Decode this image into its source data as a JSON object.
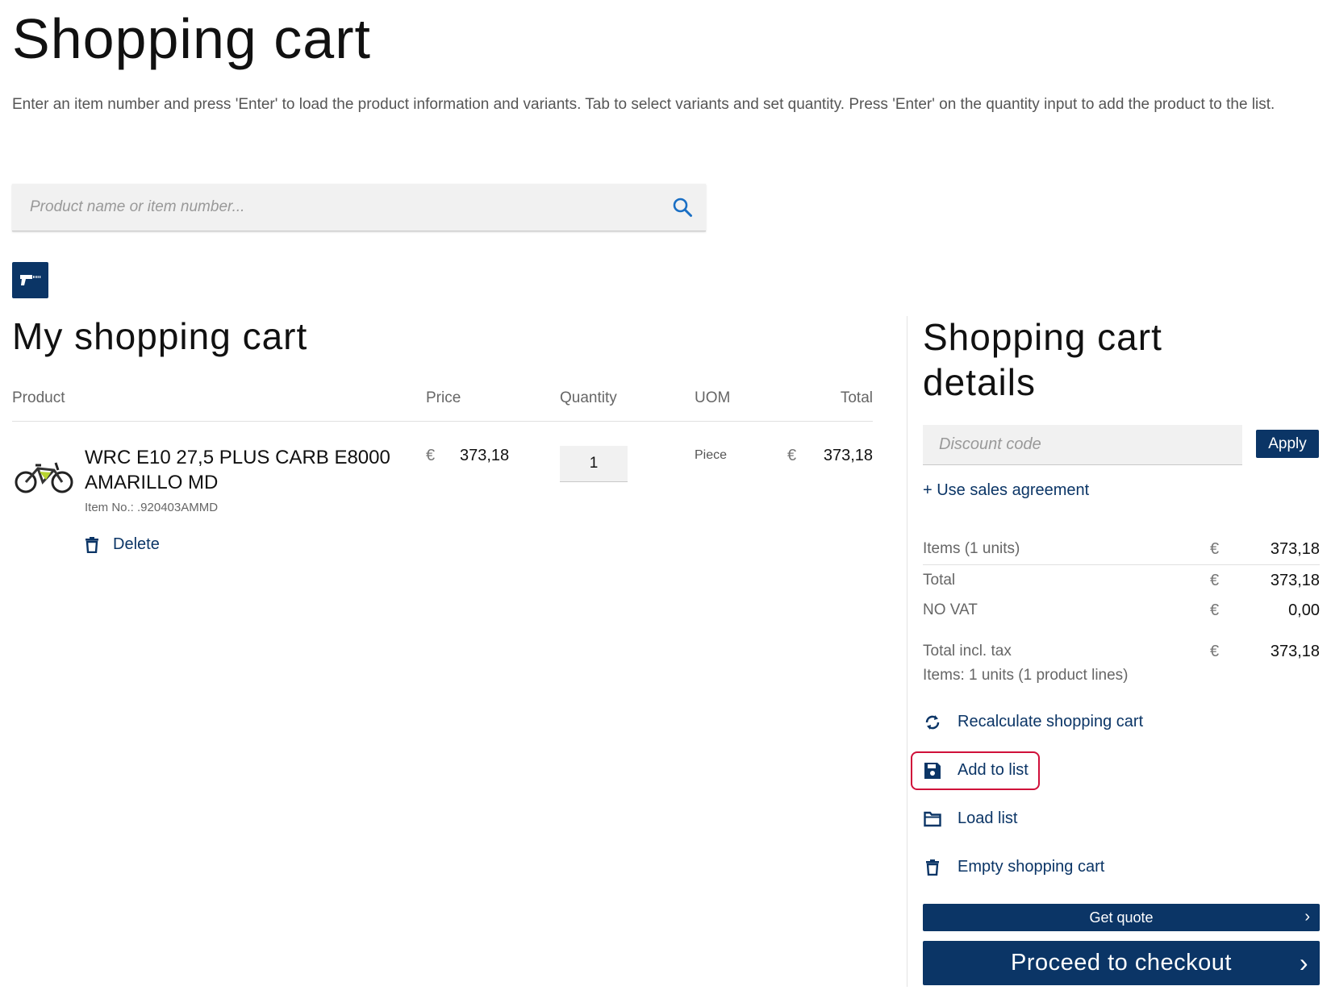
{
  "page": {
    "title": "Shopping cart",
    "instructions": "Enter an item number and press 'Enter' to load the product information and variants. Tab to select variants and set quantity. Press 'Enter' on the quantity input to add the product to the list."
  },
  "search": {
    "placeholder": "Product name or item number...",
    "icon": "search-icon"
  },
  "scanner": {
    "icon": "barcode-scanner-icon"
  },
  "cart": {
    "title": "My shopping cart",
    "columns": {
      "product": "Product",
      "price": "Price",
      "quantity": "Quantity",
      "uom": "UOM",
      "total": "Total"
    },
    "lines": [
      {
        "name": "WRC E10 27,5 PLUS CARB E8000 AMARILLO MD",
        "item_no": "Item No.: .920403AMMD",
        "price_currency": "€",
        "price": "373,18",
        "quantity": "1",
        "uom": "Piece",
        "total_currency": "€",
        "total": "373,18",
        "delete_label": "Delete"
      }
    ]
  },
  "details": {
    "title_line1": "Shopping cart",
    "title_line2": "details",
    "discount_placeholder": "Discount code",
    "apply_label": "Apply",
    "sales_agreement": "+ Use sales agreement",
    "summary": {
      "items_label": "Items (1 units)",
      "items_currency": "€",
      "items_value": "373,18",
      "total_label": "Total",
      "total_currency": "€",
      "total_value": "373,18",
      "vat_label": "NO VAT",
      "vat_currency": "€",
      "vat_value": "0,00",
      "incl_label": "Total incl. tax",
      "incl_currency": "€",
      "incl_value": "373,18",
      "lines_info": "Items: 1 units (1 product lines)"
    },
    "actions": {
      "recalculate": "Recalculate shopping cart",
      "add_to_list": "Add to list",
      "load_list": "Load list",
      "empty": "Empty shopping cart"
    },
    "get_quote": "Get quote",
    "checkout": "Proceed to checkout",
    "chevron": "›"
  },
  "colors": {
    "brand": "#0b3566",
    "highlight": "#d0103a"
  }
}
